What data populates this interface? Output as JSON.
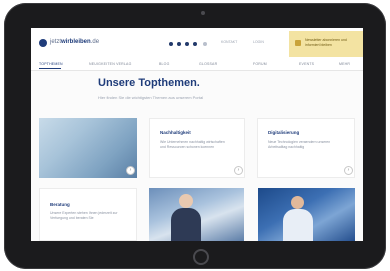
{
  "site": {
    "logo_prefix": "jetzt",
    "logo_bold": "wirbleiben",
    "logo_suffix": ".de",
    "header_links": [
      "KONTAKT",
      "LOGIN"
    ],
    "promo_text": "Newsletter abonnieren und informiert bleiben"
  },
  "nav": {
    "items": [
      "TOPTHEMEN",
      "NEUIGKEITEN VERLAG",
      "BLOG",
      "GLOSSAR",
      "FORUM",
      "EVENTS",
      "MEHR"
    ]
  },
  "main": {
    "title": "Unsere Topthemen.",
    "subtitle": "Hier finden Sie die wichtigsten Themen aus unserem Portal"
  },
  "cards": [
    {
      "title": "Nachhaltigkeit",
      "text": "Wie Unternehmen nachhaltig wirtschaften und Ressourcen schonen koennen"
    },
    {
      "title": "Digitalisierung",
      "text": "Neue Technologien veraendern unseren Arbeitsalltag nachhaltig"
    }
  ],
  "small_card": {
    "title": "Beratung",
    "text": "Unsere Experten stehen Ihnen jederzeit zur Verfuegung und beraten Sie"
  },
  "icons": {
    "arrow": "chevron-right-icon"
  },
  "colors": {
    "brand": "#1f3c7a",
    "promo": "#f3e3a2"
  }
}
